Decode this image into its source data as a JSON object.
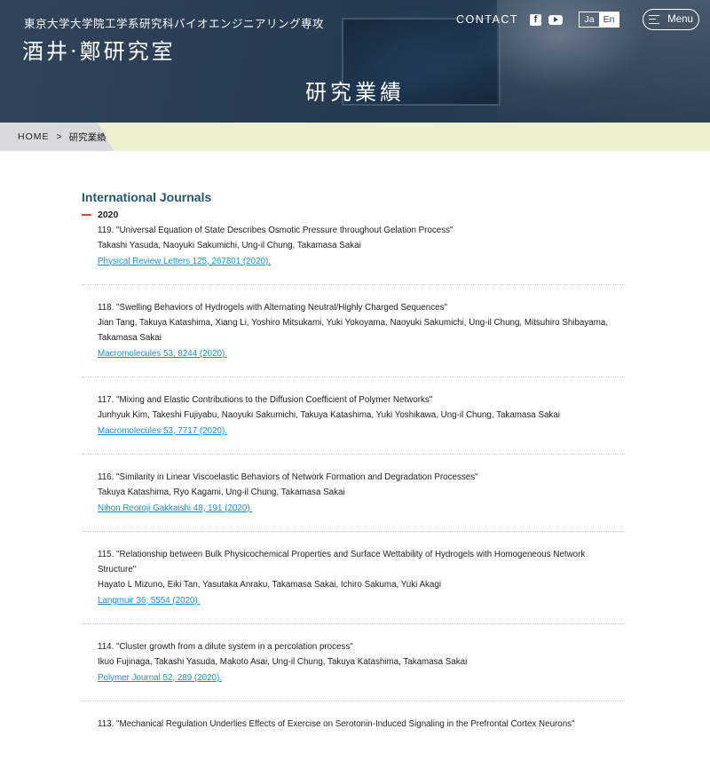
{
  "header": {
    "department": "東京大学大学院工学系研究科バイオエンジニアリング専攻",
    "lab_name": "酒井·鄭研究室",
    "page_title": "研究業績",
    "contact_label": "CONTACT",
    "social": [
      {
        "icon": "facebook-icon",
        "glyph": "f"
      },
      {
        "icon": "youtube-icon"
      }
    ],
    "lang": {
      "ja": "Ja",
      "en": "En",
      "active": "en"
    },
    "menu_label": "Menu"
  },
  "breadcrumb": {
    "home": "HOME",
    "separator": ">",
    "current": "研究業績"
  },
  "main": {
    "section_title": "International Journals",
    "year": "2020",
    "entries": [
      {
        "title": "119. \"Universal Equation of State Describes Osmotic Pressure throughout Gelation Process\"",
        "authors": "Takashi Yasuda, Naoyuki Sakumichi, Ung-il Chung, Takamasa Sakai",
        "ref": "Physical Review Letters 125, 267801 (2020)."
      },
      {
        "title": "118. \"Swelling Behaviors of Hydrogels with Alternating Neutral/Highly Charged Sequences\"",
        "authors": "Jian Tang, Takuya Katashima, Xiang Li, Yoshiro Mitsukami, Yuki Yokoyama, Naoyuki Sakumichi, Ung-il Chung, Mitsuhiro Shibayama, Takamasa Sakai",
        "ref": "Macromolecules 53, 8244 (2020)."
      },
      {
        "title": "117. \"Mixing and Elastic Contributions to the Diffusion Coefficient of Polymer Networks\"",
        "authors": "Junhyuk Kim, Takeshi Fujiyabu, Naoyuki Sakumichi, Takuya Katashima, Yuki Yoshikawa, Ung-il Chung, Takamasa Sakai",
        "ref": "Macromolecules 53, 7717 (2020)."
      },
      {
        "title": "116. \"Similarity in Linear Viscoelastic Behaviors of Network Formation and Degradation Processes\"",
        "authors": "Takuya Katashima, Ryo Kagami, Ung-il Chung, Takamasa Sakai",
        "ref": "Nihon Reoroji Gakkaishi 48, 191 (2020)."
      },
      {
        "title": "115. \"Relationship between Bulk Physicochemical Properties and Surface Wettability of Hydrogels with Homogeneous Network Structure\"",
        "authors": "Hayato L Mizuno, Eiki Tan, Yasutaka Anraku, Takamasa Sakai, Ichiro Sakuma, Yuki Akagi",
        "ref": "Langmuir 36, 5554 (2020)."
      },
      {
        "title": "114. \"Cluster growth from a dilute system in a percolation process\"",
        "authors": "Ikuo Fujinaga, Takashi Yasuda, Makoto Asai, Ung-il Chung, Takuya Katashima, Takamasa Sakai",
        "ref": "Polymer Journal 52, 289 (2020)."
      },
      {
        "title": "113. \"Mechanical Regulation Underlies Effects of Exercise on Serotonin-Induced Signaling in the Prefrontal Cortex Neurons\"",
        "authors": "",
        "ref": ""
      }
    ]
  }
}
